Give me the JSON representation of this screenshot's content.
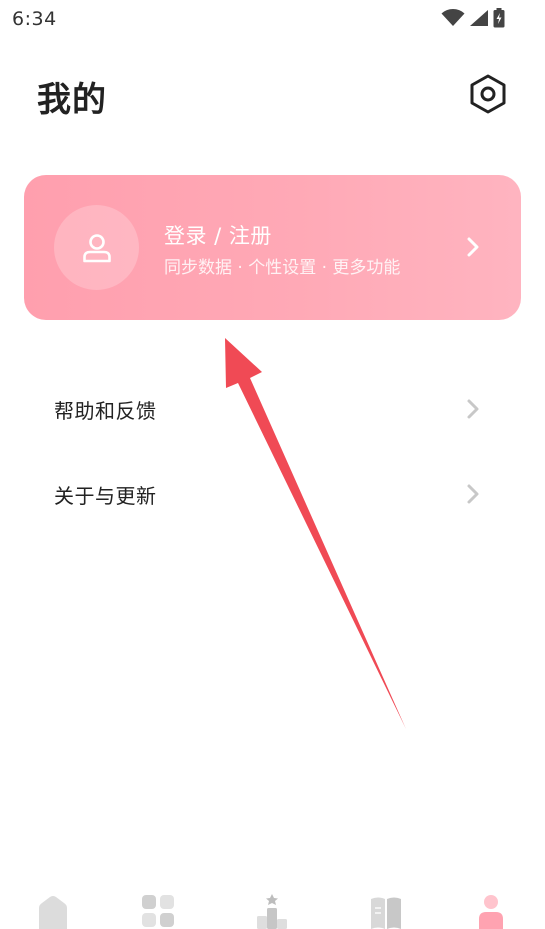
{
  "status_bar": {
    "time": "6:34",
    "icons": [
      "wifi-icon",
      "cell-signal-icon",
      "battery-charging-icon"
    ]
  },
  "header": {
    "title": "我的",
    "settings_icon": "settings-hexagon-icon"
  },
  "login_card": {
    "title": "登录 / 注册",
    "subtitle": "同步数据 · 个性设置 · 更多功能",
    "avatar_icon": "user-icon",
    "chevron_icon": "chevron-right-icon",
    "gradient_start": "#ff9fae",
    "gradient_end": "#ffb4c0"
  },
  "menu": {
    "items": [
      {
        "label": "帮助和反馈",
        "icon": "chevron-right-icon"
      },
      {
        "label": "关于与更新",
        "icon": "chevron-right-icon"
      }
    ]
  },
  "bottom_nav": {
    "items": [
      {
        "icon": "home-icon",
        "active": false
      },
      {
        "icon": "grid-icon",
        "active": false
      },
      {
        "icon": "ranking-icon",
        "active": false
      },
      {
        "icon": "book-icon",
        "active": false
      },
      {
        "icon": "person-icon",
        "active": true
      }
    ],
    "active_color": "#ffa3b1",
    "inactive_color": "#dcdcdc"
  },
  "annotation": {
    "type": "arrow",
    "color": "#f04a55"
  }
}
